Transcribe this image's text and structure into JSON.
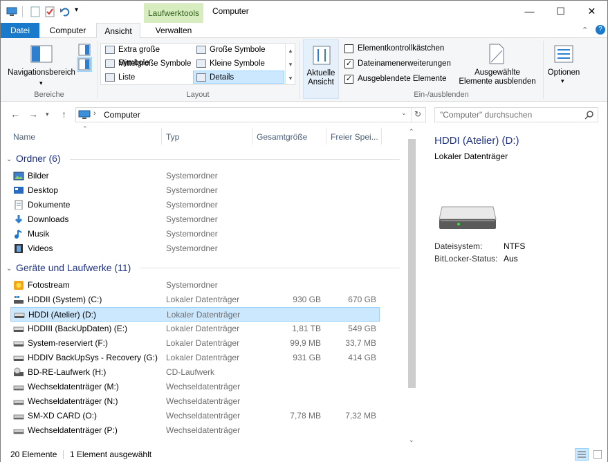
{
  "window": {
    "title": "Computer",
    "context_tab": "Laufwerktools",
    "controls": {
      "minimize": "—",
      "maximize": "☐",
      "close": "✕"
    }
  },
  "tabs": [
    {
      "label": "Datei"
    },
    {
      "label": "Computer"
    },
    {
      "label": "Ansicht"
    },
    {
      "label": "Verwalten"
    }
  ],
  "ribbon": {
    "nav_pane_label": "Navigationsbereich",
    "group_panes": "Bereiche",
    "group_layout": "Layout",
    "group_showhide": "Ein-/ausblenden",
    "layout_items": [
      "Extra große Symbole",
      "Große Symbole",
      "Mittelgroße Symbole",
      "Kleine Symbole",
      "Liste",
      "Details"
    ],
    "current_view_label": "Aktuelle Ansicht",
    "checkboxes": [
      {
        "label": "Elementkontrollkästchen",
        "checked": false
      },
      {
        "label": "Dateinamenerweiterungen",
        "checked": true
      },
      {
        "label": "Ausgeblendete Elemente",
        "checked": true
      }
    ],
    "hide_selected_label_1": "Ausgewählte",
    "hide_selected_label_2": "Elemente ausblenden",
    "options_label": "Optionen"
  },
  "address": {
    "path": "Computer",
    "search_placeholder": "\"Computer\" durchsuchen"
  },
  "columns": [
    "Name",
    "Typ",
    "Gesamtgröße",
    "Freier Spei..."
  ],
  "groups": {
    "folders": "Ordner (6)",
    "drives": "Geräte und Laufwerke (11)"
  },
  "folders": [
    {
      "name": "Bilder",
      "type": "Systemordner",
      "icon": "pictures-icon"
    },
    {
      "name": "Desktop",
      "type": "Systemordner",
      "icon": "desktop-icon"
    },
    {
      "name": "Dokumente",
      "type": "Systemordner",
      "icon": "documents-icon"
    },
    {
      "name": "Downloads",
      "type": "Systemordner",
      "icon": "downloads-icon"
    },
    {
      "name": "Musik",
      "type": "Systemordner",
      "icon": "music-icon"
    },
    {
      "name": "Videos",
      "type": "Systemordner",
      "icon": "videos-icon"
    }
  ],
  "drives": [
    {
      "name": "Fotostream",
      "type": "Systemordner",
      "size": "",
      "free": "",
      "icon": "photostream-icon"
    },
    {
      "name": "HDDII (System) (C:)",
      "type": "Lokaler Datenträger",
      "size": "930 GB",
      "free": "670 GB",
      "icon": "system-drive-icon"
    },
    {
      "name": "HDDI (Atelier) (D:)",
      "type": "Lokaler Datenträger",
      "size": "",
      "free": "",
      "icon": "drive-icon",
      "selected": true
    },
    {
      "name": "HDDIII (BackUpDaten) (E:)",
      "type": "Lokaler Datenträger",
      "size": "1,81 TB",
      "free": "549 GB",
      "icon": "drive-icon"
    },
    {
      "name": "System-reserviert (F:)",
      "type": "Lokaler Datenträger",
      "size": "99,9 MB",
      "free": "33,7 MB",
      "icon": "drive-icon"
    },
    {
      "name": "HDDIV BackUpSys - Recovery (G:)",
      "type": "Lokaler Datenträger",
      "size": "931 GB",
      "free": "414 GB",
      "icon": "drive-icon"
    },
    {
      "name": "BD-RE-Laufwerk (H:)",
      "type": "CD-Laufwerk",
      "size": "",
      "free": "",
      "icon": "optical-drive-icon"
    },
    {
      "name": "Wechseldatenträger (M:)",
      "type": "Wechseldatenträger",
      "size": "",
      "free": "",
      "icon": "removable-drive-icon"
    },
    {
      "name": "Wechseldatenträger (N:)",
      "type": "Wechseldatenträger",
      "size": "",
      "free": "",
      "icon": "removable-drive-icon"
    },
    {
      "name": "SM-XD CARD (O:)",
      "type": "Wechseldatenträger",
      "size": "7,78 MB",
      "free": "7,32 MB",
      "icon": "removable-drive-icon"
    },
    {
      "name": "Wechseldatenträger (P:)",
      "type": "Wechseldatenträger",
      "size": "",
      "free": "",
      "icon": "removable-drive-icon"
    }
  ],
  "details": {
    "title": "HDDI (Atelier) (D:)",
    "subtitle": "Lokaler Datenträger",
    "filesystem_label": "Dateisystem:",
    "filesystem_value": "NTFS",
    "bitlocker_label": "BitLocker-Status:",
    "bitlocker_value": "Aus"
  },
  "status": {
    "count": "20 Elemente",
    "selection": "1 Element ausgewählt"
  },
  "colors": {
    "accent": "#1979ca",
    "group_heading": "#1e3287",
    "selection": "#cce8ff",
    "context_tab": "#d7ecbf"
  }
}
